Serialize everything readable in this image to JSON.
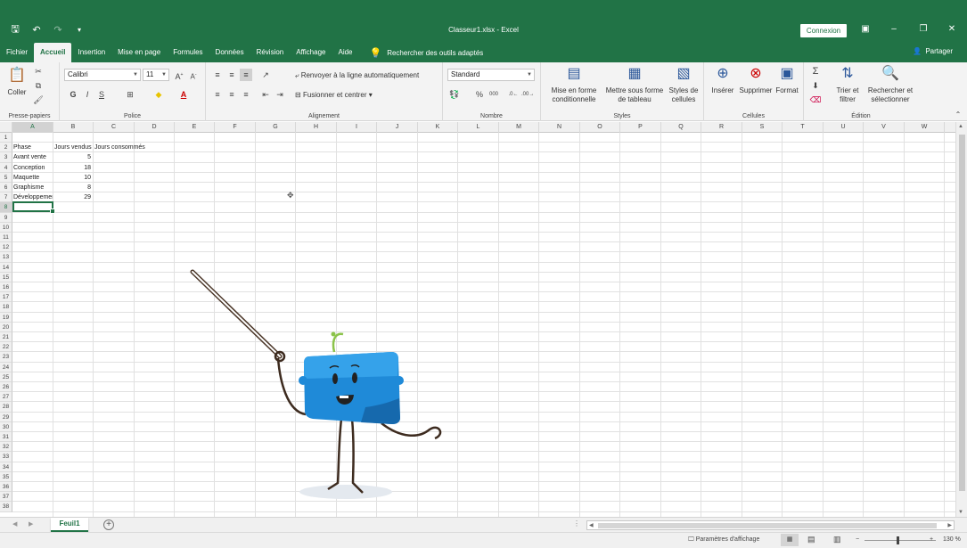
{
  "window": {
    "title": "Classeur1.xlsx  -  Excel",
    "signin_label": "Connexion",
    "share_label": "Partager"
  },
  "tabs": [
    "Fichier",
    "Accueil",
    "Insertion",
    "Mise en page",
    "Formules",
    "Données",
    "Révision",
    "Affichage",
    "Aide"
  ],
  "tellme": "Rechercher des outils adaptés",
  "ribbon": {
    "clipboard": {
      "paste_label": "Coller",
      "group_label": "Presse-papiers"
    },
    "font": {
      "name": "Calibri",
      "size": "11",
      "group_label": "Police"
    },
    "alignment": {
      "wrap_label": "Renvoyer à la ligne automatiquement",
      "merge_label": "Fusionner et centrer",
      "group_label": "Alignement"
    },
    "number": {
      "format": "Standard",
      "group_label": "Nombre"
    },
    "styles": {
      "conditional_label": "Mise en forme conditionnelle",
      "table_label": "Mettre sous forme de tableau",
      "cell_styles_label": "Styles de cellules",
      "group_label": "Styles"
    },
    "cells": {
      "insert_label": "Insérer",
      "delete_label": "Supprimer",
      "format_label": "Format",
      "group_label": "Cellules"
    },
    "editing": {
      "sort_label": "Trier et filtrer",
      "find_label": "Rechercher et sélectionner",
      "group_label": "Édition"
    }
  },
  "grid": {
    "columns": [
      "A",
      "B",
      "C",
      "D",
      "E",
      "F",
      "G",
      "H",
      "I",
      "J",
      "K",
      "L",
      "M",
      "N",
      "O",
      "P",
      "Q",
      "R",
      "S",
      "T",
      "U",
      "V",
      "W"
    ],
    "row_count": 38,
    "selected_cell": "A8",
    "headers": [
      "Phase",
      "Jours vendus",
      "Jours consommés"
    ],
    "rows": [
      [
        "Avant vente",
        "5"
      ],
      [
        "Conception",
        "18"
      ],
      [
        "Maquette",
        "10"
      ],
      [
        "Graphisme",
        "8"
      ],
      [
        "Développement",
        "29"
      ]
    ]
  },
  "sheet": {
    "tab_label": "Feuil1",
    "add_symbol": "+"
  },
  "status": {
    "display_settings": "Paramètres d'affichage",
    "zoom": "130 %"
  }
}
